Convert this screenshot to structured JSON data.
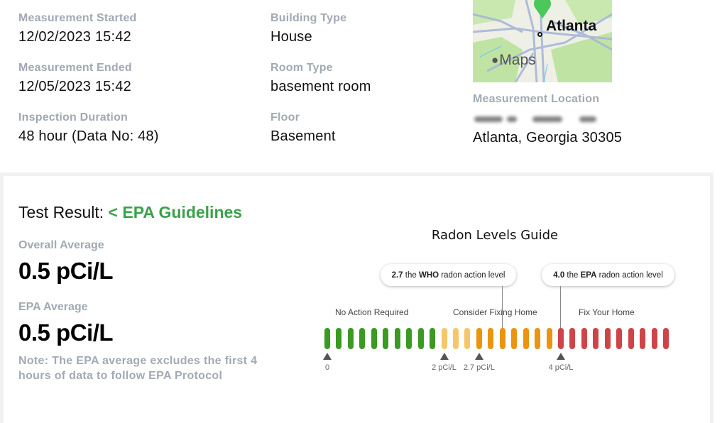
{
  "details": {
    "col1": [
      {
        "label": "Measurement Started",
        "value": "12/02/2023 15:42"
      },
      {
        "label": "Measurement Ended",
        "value": "12/05/2023 15:42"
      },
      {
        "label": "Inspection Duration",
        "value": "48 hour (Data No: 48)"
      }
    ],
    "col2": [
      {
        "label": "Building Type",
        "value": "House"
      },
      {
        "label": "Room Type",
        "value": "basement room"
      },
      {
        "label": "Floor",
        "value": "Basement"
      }
    ]
  },
  "map": {
    "city_label": "Atlanta",
    "brand": "Maps",
    "pin_color": "#4cc75a",
    "icon": "apple-logo-icon"
  },
  "location": {
    "label": "Measurement Location",
    "street_redacted": true,
    "city_state_zip": "Atlanta, Georgia 30305"
  },
  "result": {
    "prefix": "Test Result: ",
    "status": "< EPA Guidelines",
    "status_color": "#3aa24a",
    "overall_label": "Overall Average",
    "overall_value": "0.5 pCi/L",
    "epa_label": "EPA Average",
    "epa_value": "0.5 pCi/L",
    "note": "Note: The EPA average excludes the first 4 hours of data to follow EPA Protocol"
  },
  "guide": {
    "title": "Radon Levels Guide",
    "who_callout": {
      "value": "2.7",
      "t1": " the ",
      "org": "WHO",
      "t2": " radon action level"
    },
    "epa_callout": {
      "value": "4.0",
      "t1": " the ",
      "org": "EPA",
      "t2": " radon action level"
    },
    "zones": [
      "No Action Required",
      "Consider Fixing Home",
      "Fix Your Home"
    ],
    "segments": [
      {
        "count": 10,
        "color": "#3a9a22"
      },
      {
        "count": 3,
        "color": "#f5c76a"
      },
      {
        "count": 7,
        "color": "#eb940f"
      },
      {
        "count": 10,
        "color": "#cf4447"
      }
    ],
    "markers": [
      {
        "bar_index": 0,
        "label": "0"
      },
      {
        "bar_index": 10,
        "label": "2 pCi/L"
      },
      {
        "bar_index": 13,
        "label": "2.7 pCi/L"
      },
      {
        "bar_index": 20,
        "label": "4 pCi/L"
      }
    ]
  }
}
